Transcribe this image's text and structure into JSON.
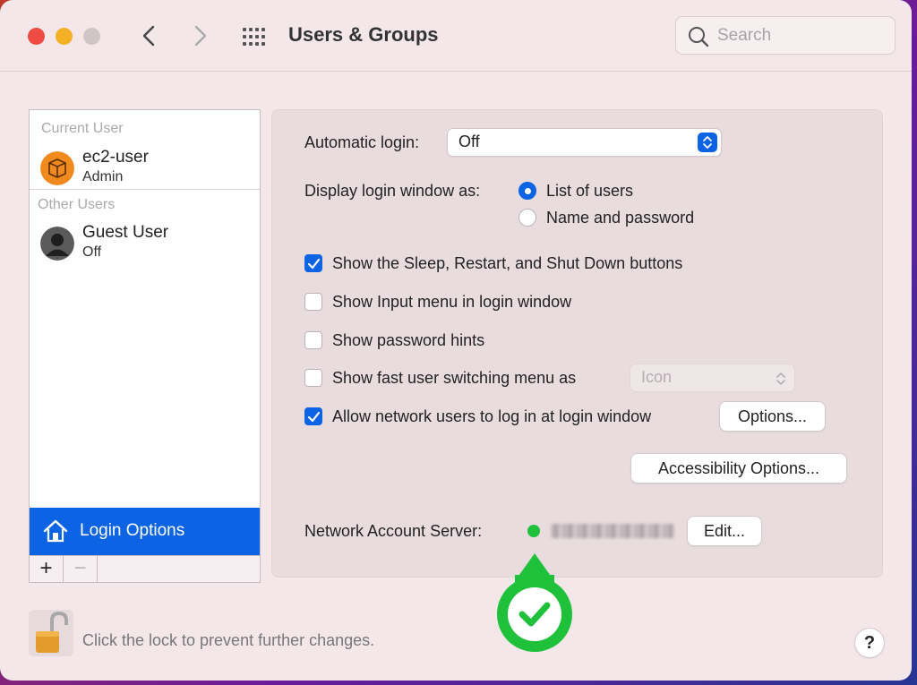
{
  "window": {
    "title": "Users & Groups",
    "search": {
      "placeholder": "Search",
      "value": ""
    }
  },
  "sidebar": {
    "current_user_label": "Current User",
    "current_user": {
      "name": "ec2-user",
      "role": "Admin"
    },
    "other_users_label": "Other Users",
    "other_users": [
      {
        "name": "Guest User",
        "status": "Off"
      }
    ],
    "login_options_label": "Login Options",
    "add_label": "+",
    "remove_label": "−"
  },
  "login": {
    "automatic_login_label": "Automatic login:",
    "automatic_login_value": "Off",
    "display_login_label": "Display login window as:",
    "display_options": [
      {
        "label": "List of users",
        "selected": true
      },
      {
        "label": "Name and password",
        "selected": false
      }
    ],
    "checkboxes": [
      {
        "label": "Show the Sleep, Restart, and Shut Down buttons",
        "checked": true
      },
      {
        "label": "Show Input menu in login window",
        "checked": false
      },
      {
        "label": "Show password hints",
        "checked": false
      },
      {
        "label": "Show fast user switching menu as",
        "checked": false
      },
      {
        "label": "Allow network users to log in at login window",
        "checked": true
      }
    ],
    "fast_switch_value": "Icon",
    "options_button": "Options...",
    "accessibility_button": "Accessibility Options...",
    "network_server_label": "Network Account Server:",
    "network_server_status": "connected",
    "edit_button": "Edit..."
  },
  "footer": {
    "lock_text": "Click the lock to prevent further changes.",
    "help_label": "?"
  },
  "colors": {
    "accent": "#0c63e4",
    "status_ok": "#1fc13a",
    "badge_green": "#1fc13a"
  },
  "icons": {
    "back": "chevron-left-icon",
    "forward": "chevron-right-icon",
    "grid": "grid-icon",
    "search": "search-icon",
    "lock": "unlocked-padlock-icon",
    "home": "house-icon",
    "check_badge": "checkmark-badge-icon"
  }
}
